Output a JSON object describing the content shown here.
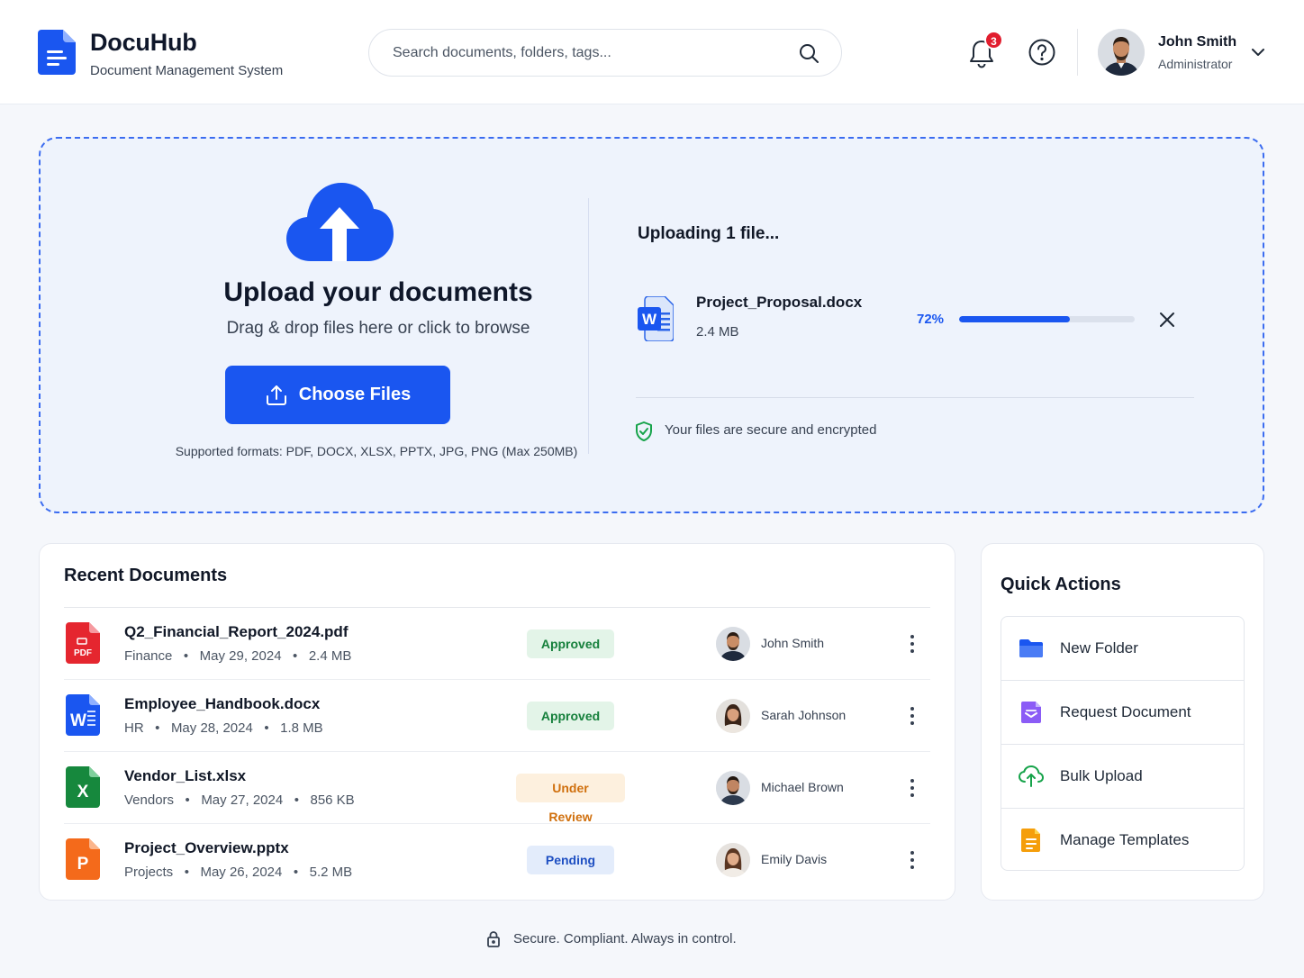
{
  "app": {
    "name": "DocuHub",
    "subtitle": "Document Management System"
  },
  "search": {
    "placeholder": "Search documents, folders, tags...",
    "icon": "search-icon"
  },
  "notifications": {
    "count": "3",
    "icon": "bell-icon"
  },
  "help": {
    "icon": "help-circle-icon"
  },
  "user": {
    "name": "John Smith",
    "role": "Administrator"
  },
  "upload": {
    "title": "Upload your documents",
    "subtitle": "Drag & drop files here or click to browse",
    "button_label": "Choose Files",
    "formats": "Supported formats: PDF, DOCX, XLSX, PPTX, JPG, PNG (Max 250MB)",
    "status_title": "Uploading 1 file...",
    "file": {
      "name": "Project_Proposal.docx",
      "size": "2.4 MB",
      "percent_label": "72%",
      "progress": 0.63
    },
    "secure_note": "Your files are secure and encrypted"
  },
  "recent": {
    "title": "Recent Documents",
    "documents": [
      {
        "name": "Q2_Financial_Report_2024.pdf",
        "category": "Finance",
        "date": "May 29, 2024",
        "size": "2.4 MB",
        "status": "Approved",
        "owner": "John Smith",
        "type": "pdf"
      },
      {
        "name": "Employee_Handbook.docx",
        "category": "HR",
        "date": "May 28, 2024",
        "size": "1.8 MB",
        "status": "Approved",
        "owner": "Sarah Johnson",
        "type": "docx"
      },
      {
        "name": "Vendor_List.xlsx",
        "category": "Vendors",
        "date": "May 27, 2024",
        "size": "856 KB",
        "status": "Under Review",
        "owner": "Michael Brown",
        "type": "xlsx"
      },
      {
        "name": "Project_Overview.pptx",
        "category": "Projects",
        "date": "May 26, 2024",
        "size": "5.2 MB",
        "status": "Pending",
        "owner": "Emily Davis",
        "type": "pptx"
      }
    ]
  },
  "quick_actions": {
    "title": "Quick Actions",
    "items": [
      {
        "label": "New Folder",
        "icon": "folder-icon"
      },
      {
        "label": "Request Document",
        "icon": "request-document-icon"
      },
      {
        "label": "Bulk Upload",
        "icon": "cloud-upload-icon"
      },
      {
        "label": "Manage Templates",
        "icon": "template-icon"
      }
    ]
  },
  "footer": {
    "text": "Secure. Compliant. Always in control."
  },
  "colors": {
    "primary": "#1a56f0",
    "approved_bg": "#e3f4e8",
    "approved_text": "#16803c",
    "review_bg": "#fdf0de",
    "review_text": "#d0700e",
    "pending_bg": "#e3ecfb",
    "pending_text": "#1e4fc2"
  }
}
